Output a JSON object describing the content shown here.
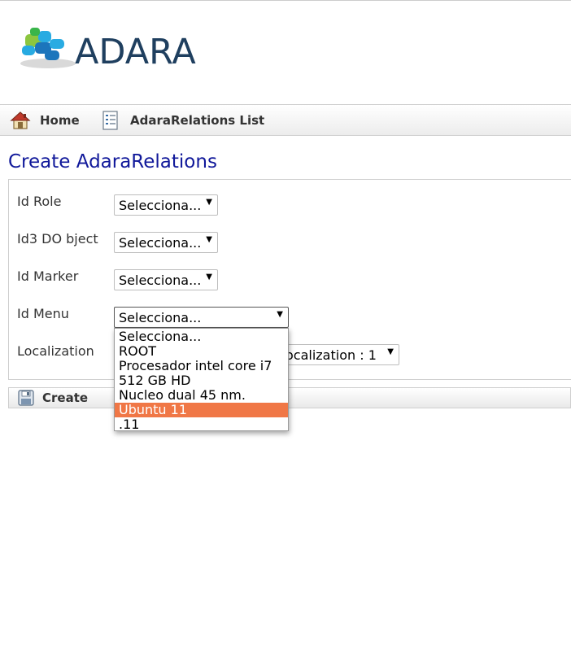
{
  "logo": {
    "text": "ADARA"
  },
  "nav": {
    "home": "Home",
    "list": "AdaraRelations List"
  },
  "page_title": "Create AdaraRelations",
  "form": {
    "fields": [
      {
        "label": "Id Role",
        "value": "Selecciona..."
      },
      {
        "label": "Id3 DO bject",
        "value": "Selecciona..."
      },
      {
        "label": "Id Marker",
        "value": "Selecciona..."
      },
      {
        "label": "Id Menu",
        "value": "Selecciona..."
      },
      {
        "label": "Localization",
        "value": "ocalization : 1"
      }
    ]
  },
  "dropdown": {
    "options": [
      "Selecciona...",
      "ROOT",
      "Procesador intel core i7",
      "512 GB HD",
      "Nucleo dual 45 nm.",
      "Ubuntu 11",
      ".11"
    ],
    "highlighted": "Ubuntu 11",
    "highlight_color": "#f07746"
  },
  "actions": {
    "create": "Create"
  },
  "colors": {
    "title": "#10189a",
    "logo_text": "#1f3f5f"
  },
  "icons": {
    "home": "house-icon",
    "list": "list-document-icon",
    "create": "save-icon"
  }
}
